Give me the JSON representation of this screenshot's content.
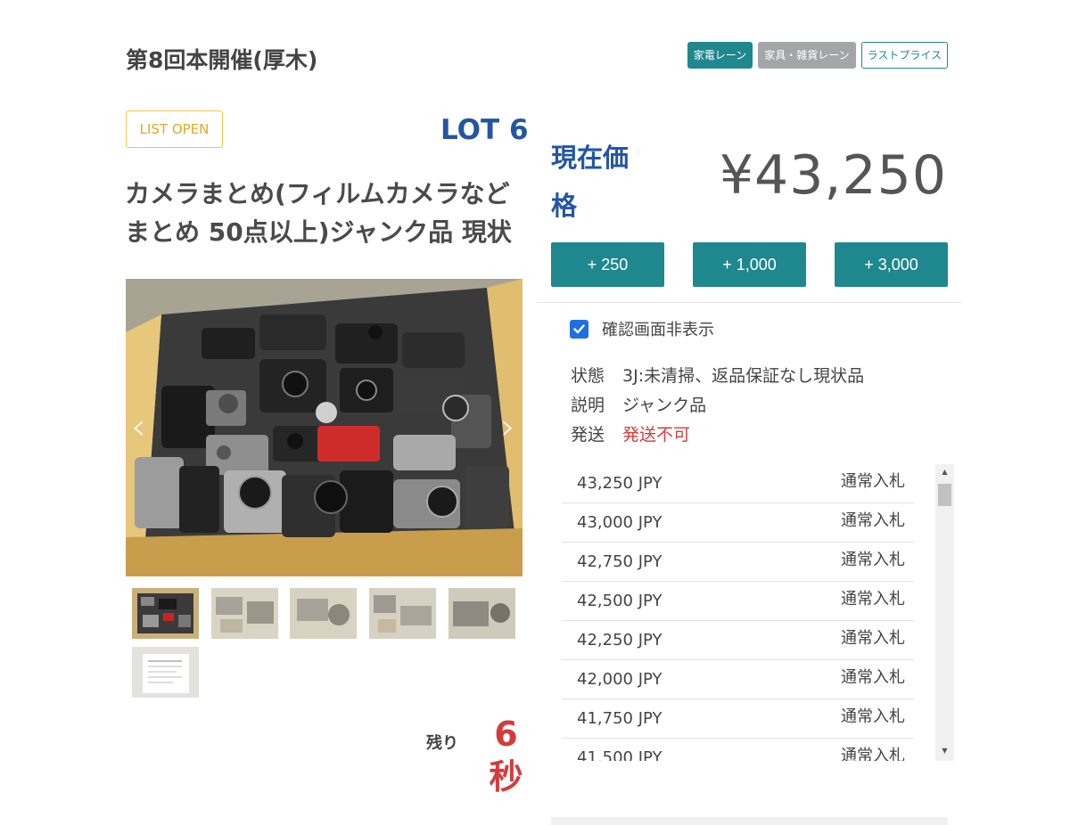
{
  "event": {
    "title": "第8回本開催(厚木)"
  },
  "lanes": [
    {
      "label": "家電レーン",
      "style": "primary"
    },
    {
      "label": "家具・雑貨レーン",
      "style": "gray"
    },
    {
      "label": "ラストプライス",
      "style": "outline"
    }
  ],
  "lot": {
    "status_badge": "LIST OPEN",
    "number_label": "LOT 6",
    "title": "カメラまとめ(フィルムカメラなどまとめ 50点以上)ジャンク品 現状"
  },
  "timer": {
    "label": "残り",
    "value": "6秒"
  },
  "price": {
    "label": "現在価格",
    "value": "¥43,250"
  },
  "bid_buttons": [
    "+ 250",
    "+ 1,000",
    "+ 3,000"
  ],
  "confirm_toggle": {
    "label": "確認画面非表示",
    "checked": true
  },
  "details": [
    {
      "key": "状態",
      "value": "3J:未清掃、返品保証なし現状品"
    },
    {
      "key": "説明",
      "value": "ジャンク品"
    },
    {
      "key": "発送",
      "value": "発送不可"
    }
  ],
  "bid_history": [
    {
      "amount": "43,250 JPY",
      "type": "通常入札"
    },
    {
      "amount": "43,000 JPY",
      "type": "通常入札"
    },
    {
      "amount": "42,750 JPY",
      "type": "通常入札"
    },
    {
      "amount": "42,500 JPY",
      "type": "通常入札"
    },
    {
      "amount": "42,250 JPY",
      "type": "通常入札"
    },
    {
      "amount": "42,000 JPY",
      "type": "通常入札"
    },
    {
      "amount": "41,750 JPY",
      "type": "通常入札"
    },
    {
      "amount": "41,500 JPY",
      "type": "通常入札"
    }
  ],
  "colors": {
    "accent": "#1f878e",
    "lot_blue": "#2356a2",
    "warning_red": "#d43c3c",
    "badge_yellow": "#e2a923"
  }
}
